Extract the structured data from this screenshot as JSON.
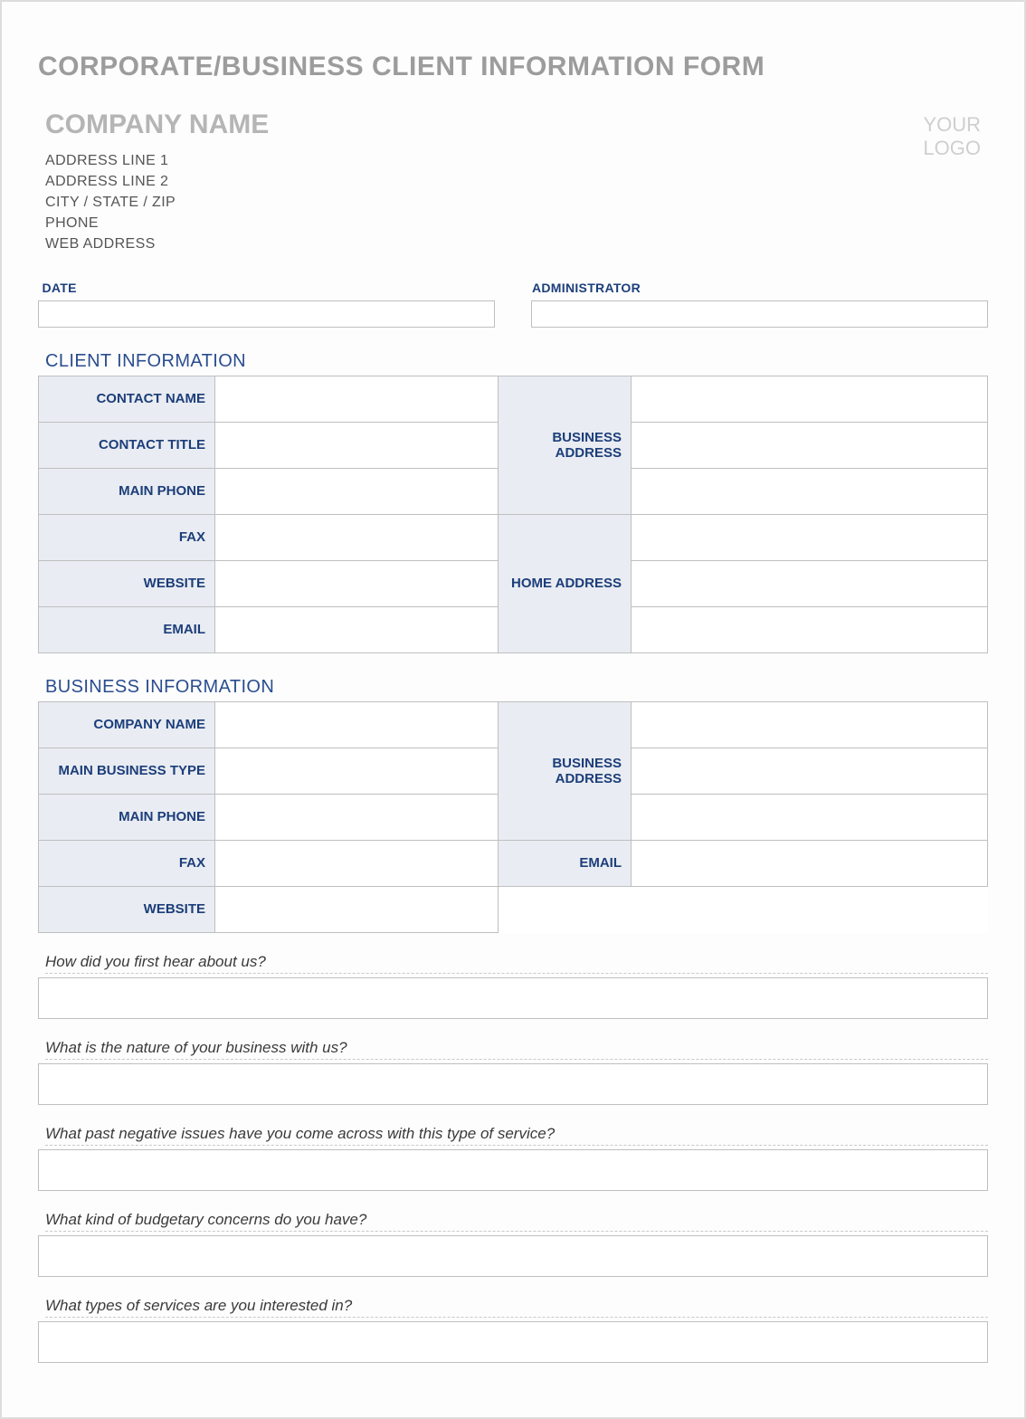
{
  "title": "CORPORATE/BUSINESS CLIENT INFORMATION FORM",
  "company": {
    "name": "COMPANY NAME",
    "address1": "ADDRESS LINE 1",
    "address2": "ADDRESS LINE 2",
    "citystatezip": "CITY / STATE / ZIP",
    "phone": "PHONE",
    "web": "WEB ADDRESS",
    "logo_line1": "YOUR",
    "logo_line2": "LOGO"
  },
  "meta": {
    "date_label": "DATE",
    "admin_label": "ADMINISTRATOR"
  },
  "client_section": {
    "heading": "CLIENT INFORMATION",
    "labels": {
      "contact_name": "CONTACT NAME",
      "contact_title": "CONTACT TITLE",
      "main_phone": "MAIN PHONE",
      "fax": "FAX",
      "website": "WEBSITE",
      "email": "EMAIL",
      "business_address": "BUSINESS ADDRESS",
      "home_address": "HOME ADDRESS"
    }
  },
  "business_section": {
    "heading": "BUSINESS INFORMATION",
    "labels": {
      "company_name": "COMPANY NAME",
      "main_business_type": "MAIN BUSINESS TYPE",
      "main_phone": "MAIN PHONE",
      "fax": "FAX",
      "website": "WEBSITE",
      "business_address": "BUSINESS ADDRESS",
      "email": "EMAIL"
    }
  },
  "questions": {
    "q1": "How did you first hear about us?",
    "q2": "What is the nature of your business with us?",
    "q3": "What past negative issues have you come across with this type of service?",
    "q4": "What kind of budgetary concerns do you have?",
    "q5": "What types of services are you interested in?"
  }
}
